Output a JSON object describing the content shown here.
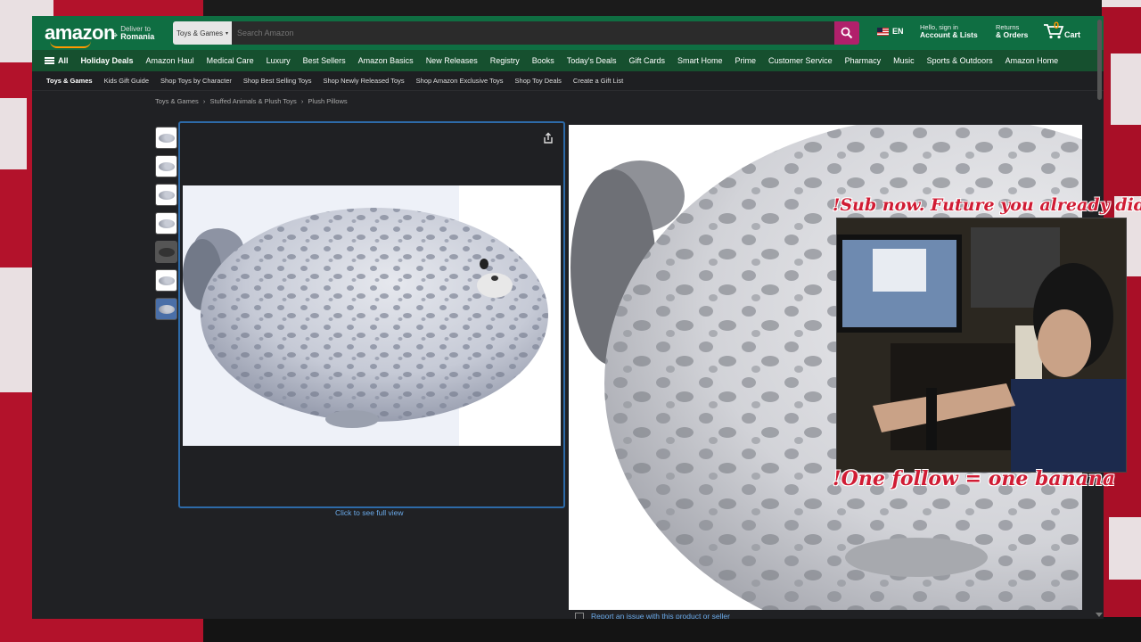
{
  "header": {
    "logo": "amazon",
    "deliver_line1": "Deliver to",
    "deliver_line2": "Romania",
    "search_category": "Toys & Games",
    "search_placeholder": "Search Amazon",
    "language": "EN",
    "account_line1": "Hello, sign in",
    "account_line2": "Account & Lists",
    "orders_line1": "Returns",
    "orders_line2": "& Orders",
    "cart_count": "0",
    "cart_label": "Cart"
  },
  "nav": {
    "all_label": "All",
    "items": [
      "Holiday Deals",
      "Amazon Haul",
      "Medical Care",
      "Luxury",
      "Best Sellers",
      "Amazon Basics",
      "New Releases",
      "Registry",
      "Books",
      "Today's Deals",
      "Gift Cards",
      "Smart Home",
      "Prime",
      "Customer Service",
      "Pharmacy",
      "Music",
      "Sports & Outdoors",
      "Amazon Home"
    ]
  },
  "subnav": {
    "items": [
      "Toys & Games",
      "Kids Gift Guide",
      "Shop Toys by Character",
      "Shop Best Selling Toys",
      "Shop Newly Released Toys",
      "Shop Amazon Exclusive Toys",
      "Shop Toy Deals",
      "Create a Gift List"
    ]
  },
  "breadcrumb": [
    "Toys & Games",
    "›",
    "Stuffed Animals & Plush Toys",
    "›",
    "Plush Pillows"
  ],
  "product": {
    "full_view_link": "Click to see full view",
    "report_link": "Report an issue with this product or seller"
  },
  "overlay": {
    "top_text": "!Sub now. Future you already did.",
    "bottom_text": "!One follow = one banana"
  },
  "colors": {
    "header_bg": "#0f6e42",
    "nav_bg": "#16502f",
    "search_button": "#b1206b",
    "overlay_red": "#d01c34",
    "link_blue": "#6aa9e8",
    "backdrop_red": "#b3122b"
  }
}
